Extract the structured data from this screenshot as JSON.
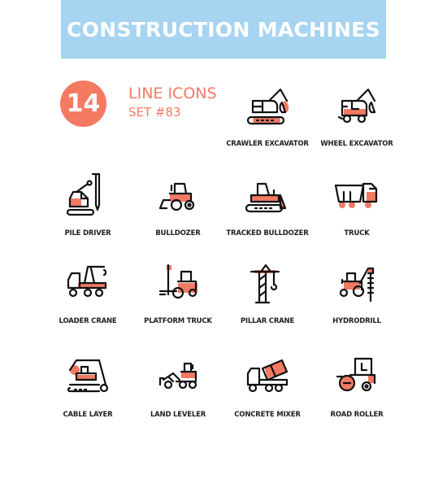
{
  "header": {
    "title": "CONSTRUCTION MACHINES"
  },
  "badge": {
    "count": "14",
    "title": "LINE ICONS",
    "subtitle": "SET #83"
  },
  "colors": {
    "banner": "#a6d4f1",
    "accent": "#f47a62",
    "line": "#111111",
    "text": "#1f1f1f"
  },
  "icons": [
    {
      "label": "CRAWLER EXCAVATOR",
      "icon": "crawler-excavator-icon"
    },
    {
      "label": "WHEEL EXCAVATOR",
      "icon": "wheel-excavator-icon"
    },
    {
      "label": "PILE DRIVER",
      "icon": "pile-driver-icon"
    },
    {
      "label": "BULLDOZER",
      "icon": "bulldozer-icon"
    },
    {
      "label": "TRACKED BULLDOZER",
      "icon": "tracked-bulldozer-icon"
    },
    {
      "label": "TRUCK",
      "icon": "truck-icon"
    },
    {
      "label": "LOADER CRANE",
      "icon": "loader-crane-icon"
    },
    {
      "label": "PLATFORM TRUCK",
      "icon": "platform-truck-icon"
    },
    {
      "label": "PILLAR CRANE",
      "icon": "pillar-crane-icon"
    },
    {
      "label": "HYDRODRILL",
      "icon": "hydrodrill-icon"
    },
    {
      "label": "CABLE LAYER",
      "icon": "cable-layer-icon"
    },
    {
      "label": "LAND LEVELER",
      "icon": "land-leveler-icon"
    },
    {
      "label": "CONCRETE MIXER",
      "icon": "concrete-mixer-icon"
    },
    {
      "label": "ROAD ROLLER",
      "icon": "road-roller-icon"
    }
  ]
}
